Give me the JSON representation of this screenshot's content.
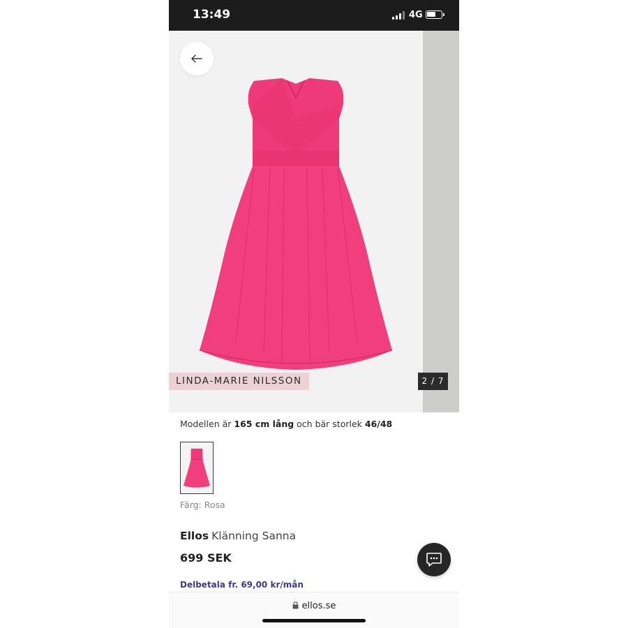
{
  "status_bar": {
    "time": "13:49",
    "network": "4G",
    "battery_level": 0.6
  },
  "gallery": {
    "brand_tag": "LINDA-MARIE NILSSON",
    "counter": "2 / 7",
    "product_image": "pink-pleated-dress",
    "dress_color": "#ee3a78"
  },
  "model_info": {
    "prefix": "Modellen är ",
    "height": "165 cm lång",
    "middle": " och bär storlek ",
    "size": "46/48"
  },
  "color": {
    "label": "Färg: Rosa"
  },
  "product": {
    "brand": "Ellos",
    "name": "Klänning Sanna",
    "price": "699 SEK"
  },
  "installment": "Delbetala fr. 69,00 kr/mån",
  "url_bar": {
    "url": "ellos.se"
  },
  "icons": {
    "back": "arrow-left-icon",
    "chat": "chat-bubble-icon",
    "lock": "lock-icon"
  }
}
